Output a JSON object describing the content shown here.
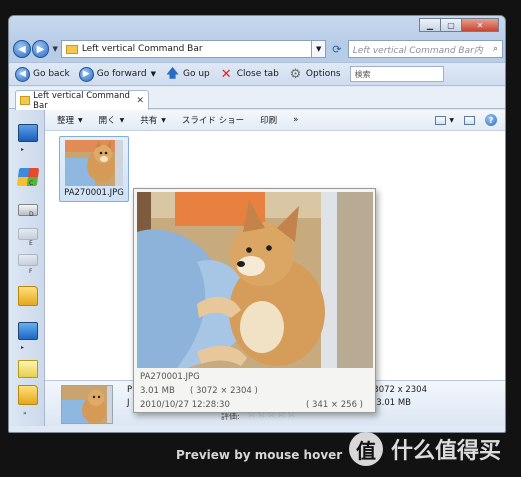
{
  "window": {
    "breadcrumb": "Left vertical Command Bar",
    "search_placeholder": "Left vertical Command Bar内",
    "caption_buttons": [
      "minimize",
      "maximize",
      "close"
    ]
  },
  "command_bar": {
    "go_back": "Go back",
    "go_forward": "Go forward",
    "go_up": "Go up",
    "close_tab": "Close tab",
    "options": "Options",
    "search_value": "検索"
  },
  "tab": {
    "label": "Left vertical Command Bar"
  },
  "command_row": {
    "organize": "整理",
    "open": "開く",
    "share": "共有",
    "slideshow": "スライド ショー",
    "print": "印刷",
    "more": "»"
  },
  "left_bar": {
    "labels": [
      "C",
      "D",
      "E",
      "F",
      "»"
    ],
    "icons": [
      "computer-icon",
      "windows-drive-icon",
      "drive-d-icon",
      "drive-e-icon",
      "drive-f-icon",
      "folder-icon",
      "control-panel-icon",
      "notes-icon",
      "folder-icon"
    ]
  },
  "file": {
    "name": "PA270001.JPG"
  },
  "details": {
    "name": "P",
    "size_label": "J",
    "dimensions": "3072 x 2304",
    "size": "3.01 MB",
    "rating_label": "評価:",
    "stars": "☆☆☆☆☆"
  },
  "preview": {
    "name": "PA270001.JPG",
    "size": "3.01 MB",
    "dimensions": "( 3072 × 2304 )",
    "date": "2010/10/27 12:28:30",
    "thumb_dims": "( 341 × 256 )"
  },
  "caption": "Preview by mouse hover",
  "watermark": {
    "glyph": "值",
    "text": "什么值得买"
  }
}
